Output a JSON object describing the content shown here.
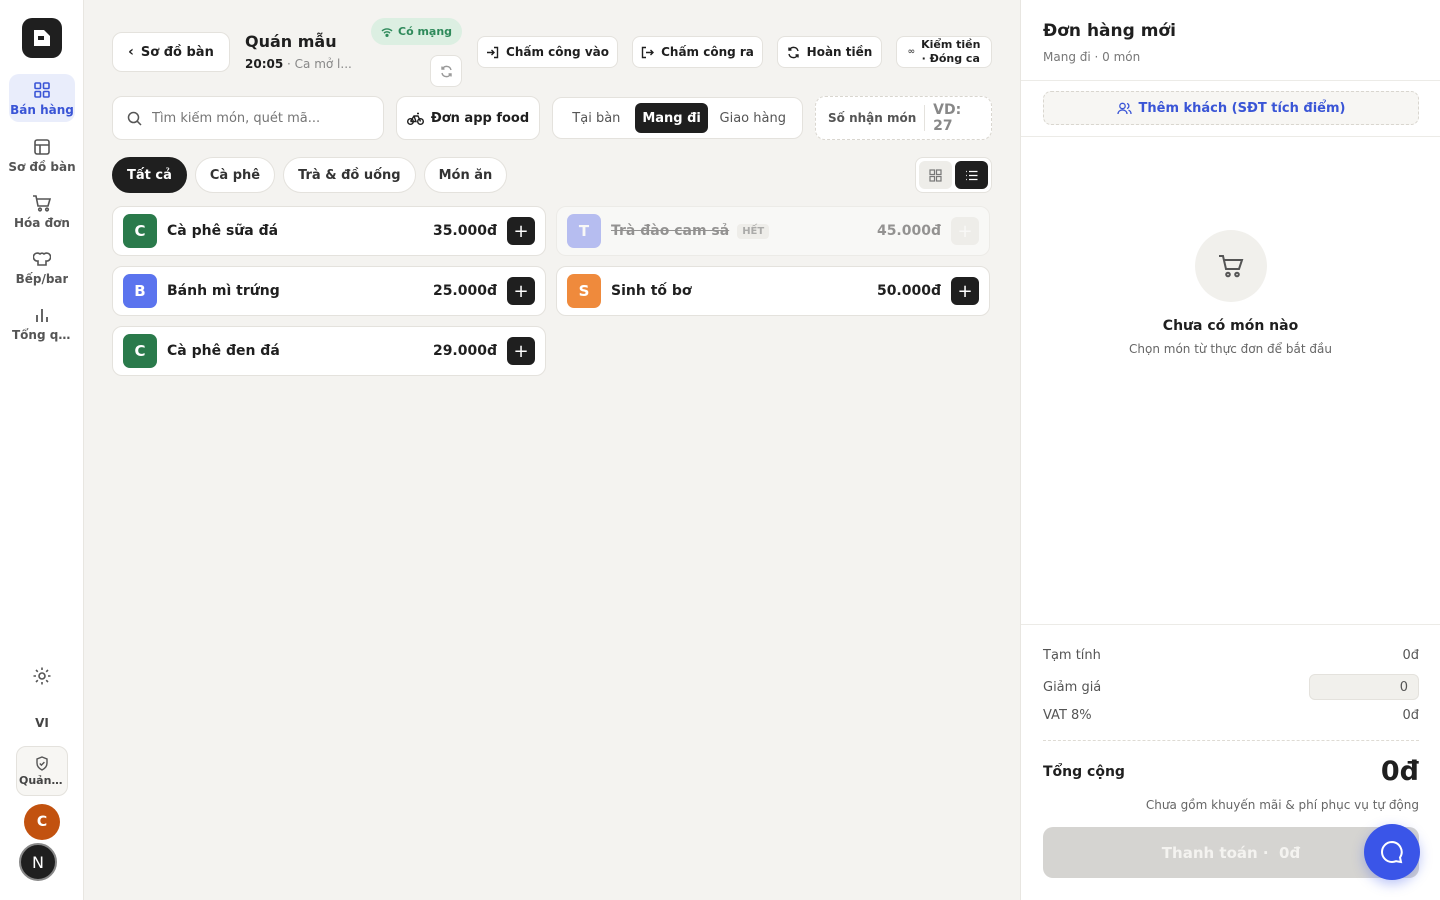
{
  "sidebar": {
    "items": [
      {
        "label": "Bán hàng",
        "icon": "grid-icon"
      },
      {
        "label": "Sơ đồ bàn",
        "icon": "table-icon"
      },
      {
        "label": "Hóa đơn",
        "icon": "cart-icon"
      },
      {
        "label": "Bếp/bar",
        "icon": "chef-hat-icon"
      },
      {
        "label": "Tổng quan",
        "icon": "bar-chart-icon"
      }
    ],
    "lang": "VI",
    "admin_label": "Quản lý",
    "avatar_c": "C",
    "avatar_n": "N"
  },
  "header": {
    "back_label": "Sơ đồ bàn",
    "store_name": "Quán mẫu",
    "time": "20:05",
    "shift": "· Ca mở l...",
    "network": "Có mạng",
    "clock_in": "Chấm công vào",
    "clock_out": "Chấm công ra",
    "refund": "Hoàn tiền",
    "cash_line1": "Kiểm tiền",
    "cash_line2": "· Đóng ca"
  },
  "toolbar": {
    "search_placeholder": "Tìm kiếm món, quét mã...",
    "app_food": "Đơn app food",
    "modes": [
      "Tại bàn",
      "Mang đi",
      "Giao hàng"
    ],
    "active_mode": "Mang đi",
    "pickup_label": "Số nhận món",
    "pickup_value": "VD: 27"
  },
  "categories": [
    "Tất cả",
    "Cà phê",
    "Trà & đồ uống",
    "Món ăn"
  ],
  "products": [
    {
      "initial": "C",
      "name": "Cà phê sữa đá",
      "price": "35.000đ",
      "color": "#2a7a4b",
      "sold_out": false
    },
    {
      "initial": "T",
      "name": "Trà đào cam sả",
      "price": "45.000đ",
      "color": "#6c7cf0",
      "sold_out": true,
      "sold_out_label": "HẾT"
    },
    {
      "initial": "B",
      "name": "Bánh mì trứng",
      "price": "25.000đ",
      "color": "#5b74ee",
      "sold_out": false
    },
    {
      "initial": "S",
      "name": "Sinh tố bơ",
      "price": "50.000đ",
      "color": "#ef8a3c",
      "sold_out": false
    },
    {
      "initial": "C",
      "name": "Cà phê đen đá",
      "price": "29.000đ",
      "color": "#2a7a4b",
      "sold_out": false
    }
  ],
  "order": {
    "title": "Đơn hàng mới",
    "subtitle": "Mang đi · 0 món",
    "add_customer": "Thêm khách (SĐT tích điểm)",
    "empty_title": "Chưa có món nào",
    "empty_hint": "Chọn món từ thực đơn để bắt đầu",
    "subtotal_label": "Tạm tính",
    "subtotal": "0đ",
    "discount_label": "Giảm giá",
    "discount_value": "0",
    "vat_label": "VAT 8%",
    "vat": "0đ",
    "total_label": "Tổng cộng",
    "total": "0đ",
    "note": "Chưa gồm khuyến mãi & phí phục vụ tự động",
    "pay_label": "Thanh toán ·  0đ"
  },
  "colors": {
    "accent": "#3a55d6",
    "dark": "#1f1f1f",
    "network": "#2f8a5b"
  }
}
